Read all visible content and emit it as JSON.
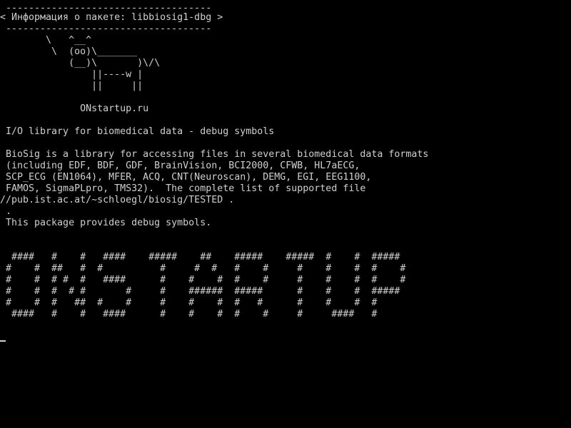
{
  "terminal": {
    "lines": [
      " ------------------------------------",
      "< Информация о пакете: libbiosig1-dbg >",
      " ------------------------------------",
      "        \\   ^__^",
      "         \\  (oo)\\_______",
      "            (__)\\       )\\/\\",
      "                ||----w |",
      "                ||     ||",
      "",
      "              ONstartup.ru",
      "",
      " I/O library for biomedical data - debug symbols",
      "",
      " BioSig is a library for accessing files in several biomedical data formats",
      " (including EDF, BDF, GDF, BrainVision, BCI2000, CFWB, HL7aECG,",
      " SCP_ECG (EN1064), MFER, ACQ, CNT(Neuroscan), DEMG, EGI, EEG1100,",
      " FAMOS, SigmaPLpro, TMS32).  The complete list of supported file",
      "//pub.ist.ac.at/~schloegl/biosig/TESTED .",
      " .",
      " This package provides debug symbols.",
      "",
      "",
      "  ####   #    #   ####    #####    ##    #####    #####  #    #  #####",
      " #    #  ##   #  #          #     #  #   #    #     #    #    #  #    #",
      " #    #  # #  #   ####      #    #    #  #    #     #    #    #  #    #",
      " #    #  #  # #       #     #    ######  #####      #    #    #  #####",
      " #    #  #   ##  #    #     #    #    #  #   #      #    #    #  #",
      "  ####   #    #   ####      #    #    #  #    #     #     ####   #"
    ]
  }
}
